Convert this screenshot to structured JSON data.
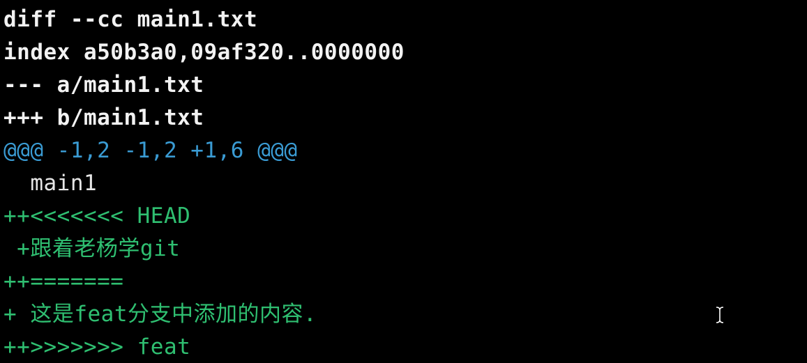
{
  "terminal": {
    "lines": [
      {
        "text": "diff --cc main1.txt",
        "kind": "header"
      },
      {
        "text": "index a50b3a0,09af320..0000000",
        "kind": "header"
      },
      {
        "text": "--- a/main1.txt",
        "kind": "header"
      },
      {
        "text": "+++ b/main1.txt",
        "kind": "header"
      },
      {
        "text": "@@@ -1,2 -1,2 +1,6 @@@",
        "kind": "hunk"
      },
      {
        "text": "  main1",
        "kind": "context"
      },
      {
        "text": "++<<<<<<< HEAD",
        "kind": "added"
      },
      {
        "text": " +跟着老杨学git",
        "kind": "added"
      },
      {
        "text": "++=======",
        "kind": "added"
      },
      {
        "text": "+ 这是feat分支中添加的内容.",
        "kind": "added"
      },
      {
        "text": "++>>>>>>> feat",
        "kind": "added"
      }
    ],
    "colors": {
      "background": "#000000",
      "header": "#f2f2f2",
      "hunk": "#3a9bd3",
      "context": "#e6e6e6",
      "added": "#2fbf71"
    },
    "cursor_icon": "text-cursor-ibeam-icon"
  }
}
